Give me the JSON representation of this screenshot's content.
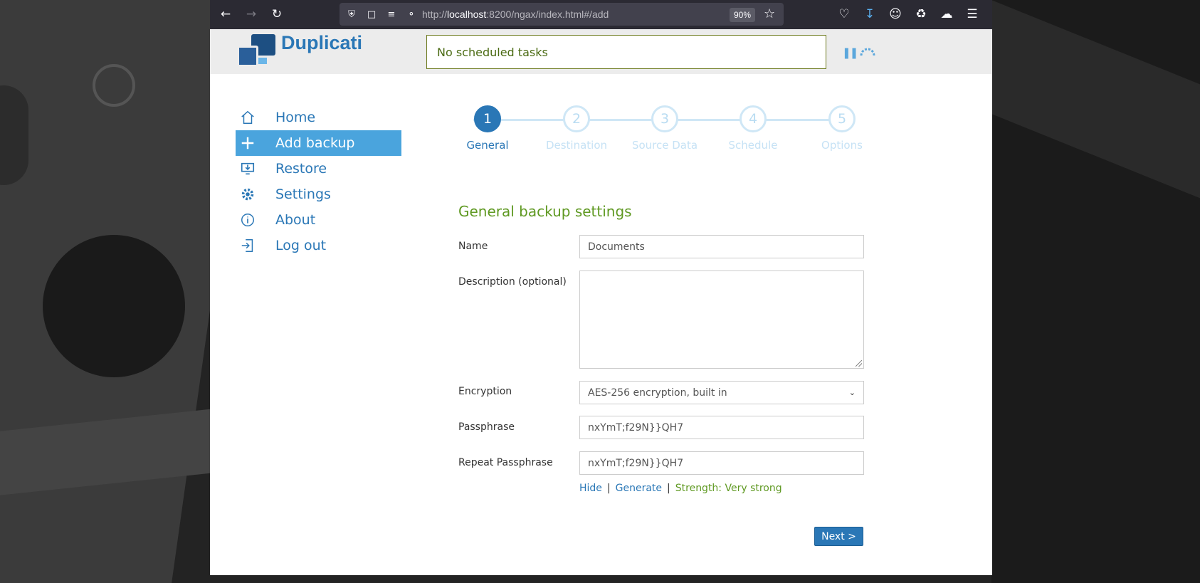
{
  "browser": {
    "url_prefix": "http://",
    "url_host": "localhost",
    "url_rest": ":8200/ngax/index.html#/add",
    "zoom": "90%"
  },
  "app": {
    "brand": "Duplicati",
    "status": "No scheduled tasks"
  },
  "nav": {
    "items": [
      {
        "label": "Home",
        "icon": "home-icon"
      },
      {
        "label": "Add backup",
        "icon": "plus-icon"
      },
      {
        "label": "Restore",
        "icon": "restore-icon"
      },
      {
        "label": "Settings",
        "icon": "gear-icon"
      },
      {
        "label": "About",
        "icon": "info-icon"
      },
      {
        "label": "Log out",
        "icon": "logout-icon"
      }
    ],
    "active_index": 1
  },
  "steps": [
    {
      "number": "1",
      "label": "General"
    },
    {
      "number": "2",
      "label": "Destination"
    },
    {
      "number": "3",
      "label": "Source Data"
    },
    {
      "number": "4",
      "label": "Schedule"
    },
    {
      "number": "5",
      "label": "Options"
    }
  ],
  "form": {
    "section_title": "General backup settings",
    "name_label": "Name",
    "name_value": "Documents",
    "description_label": "Description (optional)",
    "description_value": "",
    "encryption_label": "Encryption",
    "encryption_value": "AES-256 encryption, built in",
    "passphrase_label": "Passphrase",
    "passphrase_value": "nxYmT;f29N}}QH7",
    "repeat_label": "Repeat Passphrase",
    "repeat_value": "nxYmT;f29N}}QH7",
    "hide_link": "Hide",
    "separator": "|",
    "generate_link": "Generate",
    "strength": "Strength: Very strong",
    "next_button": "Next >"
  },
  "colors": {
    "accent": "#2a77b6",
    "nav_active": "#4aa4dd",
    "title_green": "#5f9922"
  }
}
